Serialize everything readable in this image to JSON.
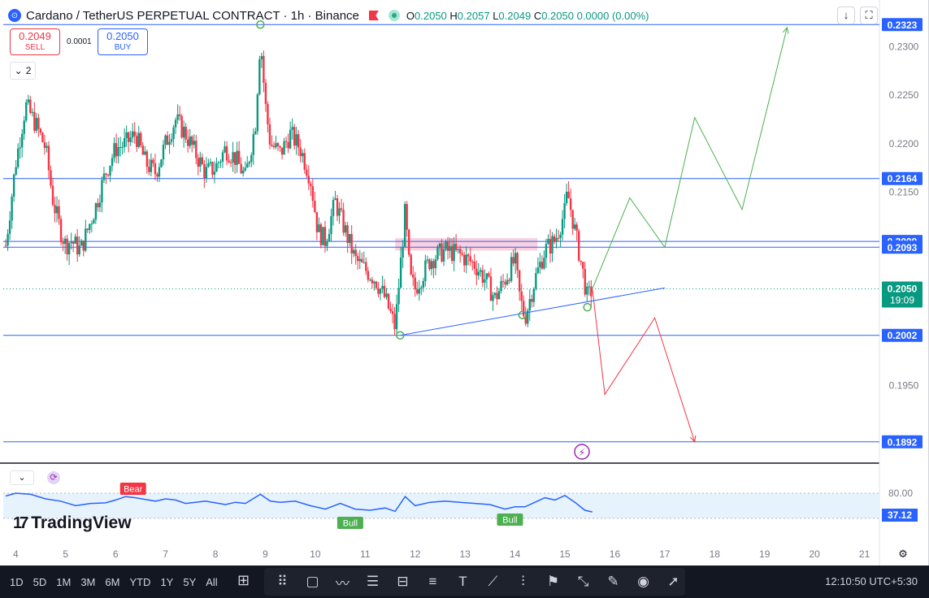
{
  "header": {
    "symbol_title": "Cardano / TetherUS PERPETUAL CONTRACT · 1h · Binance",
    "o_label": "O",
    "o_value": "0.2050",
    "h_label": "H",
    "h_value": "0.2057",
    "l_label": "L",
    "l_value": "0.2049",
    "c_label": "C",
    "c_value": "0.2050",
    "change": "0.0000 (0.00%)"
  },
  "trade": {
    "sell_price": "0.2049",
    "sell_label": "SELL",
    "spread": "0.0001",
    "buy_price": "0.2050",
    "buy_label": "BUY"
  },
  "indicators_count": "2",
  "top_icons": [
    "↓",
    "⛶"
  ],
  "branding": {
    "name": "TradingView",
    "mark": "17"
  },
  "colors": {
    "up": "#089981",
    "down": "#f23645",
    "accent": "#2962ff",
    "projection_up": "#4caf50",
    "projection_down": "#f23645"
  },
  "chart_data": {
    "type": "candlestick",
    "interval": "1h",
    "y_axis": {
      "min": 0.187,
      "max": 0.234,
      "ticks": [
        "0.2300",
        "0.2250",
        "0.2200",
        "0.2150",
        "0.1950"
      ]
    },
    "x_axis": {
      "ticks": [
        "4",
        "5",
        "6",
        "7",
        "8",
        "9",
        "10",
        "11",
        "12",
        "13",
        "14",
        "15",
        "16",
        "17",
        "18",
        "19",
        "20",
        "21"
      ]
    },
    "x_tick_values": [
      4,
      5,
      6,
      7,
      8,
      9,
      10,
      11,
      12,
      13,
      14,
      15,
      16,
      17,
      18,
      19,
      20,
      21
    ],
    "x_range": [
      3.75,
      21.3
    ],
    "close_path": [
      [
        3.8,
        0.2095
      ],
      [
        4.0,
        0.218
      ],
      [
        4.2,
        0.224
      ],
      [
        4.4,
        0.222
      ],
      [
        4.6,
        0.2195
      ],
      [
        4.75,
        0.214
      ],
      [
        4.9,
        0.211
      ],
      [
        5.0,
        0.2095
      ],
      [
        5.1,
        0.21
      ],
      [
        5.3,
        0.209
      ],
      [
        5.6,
        0.2135
      ],
      [
        5.8,
        0.217
      ],
      [
        6.0,
        0.2195
      ],
      [
        6.2,
        0.22
      ],
      [
        6.4,
        0.221
      ],
      [
        6.6,
        0.218
      ],
      [
        6.8,
        0.217
      ],
      [
        7.0,
        0.22
      ],
      [
        7.2,
        0.2225
      ],
      [
        7.4,
        0.221
      ],
      [
        7.6,
        0.219
      ],
      [
        7.8,
        0.217
      ],
      [
        8.0,
        0.2175
      ],
      [
        8.2,
        0.2195
      ],
      [
        8.4,
        0.2185
      ],
      [
        8.6,
        0.2165
      ],
      [
        8.8,
        0.222
      ],
      [
        8.9,
        0.231
      ],
      [
        9.0,
        0.224
      ],
      [
        9.1,
        0.22
      ],
      [
        9.3,
        0.219
      ],
      [
        9.5,
        0.221
      ],
      [
        9.7,
        0.2195
      ],
      [
        9.9,
        0.2165
      ],
      [
        10.05,
        0.211
      ],
      [
        10.2,
        0.21
      ],
      [
        10.4,
        0.214
      ],
      [
        10.6,
        0.211
      ],
      [
        10.8,
        0.208
      ],
      [
        11.0,
        0.207
      ],
      [
        11.2,
        0.206
      ],
      [
        11.4,
        0.204
      ],
      [
        11.6,
        0.201
      ],
      [
        11.7,
        0.207
      ],
      [
        11.8,
        0.213
      ],
      [
        11.9,
        0.206
      ],
      [
        12.0,
        0.205
      ],
      [
        12.3,
        0.208
      ],
      [
        12.6,
        0.209
      ],
      [
        12.9,
        0.2085
      ],
      [
        13.2,
        0.2075
      ],
      [
        13.4,
        0.206
      ],
      [
        13.6,
        0.204
      ],
      [
        13.8,
        0.206
      ],
      [
        14.0,
        0.208
      ],
      [
        14.1,
        0.204
      ],
      [
        14.2,
        0.202
      ],
      [
        14.4,
        0.206
      ],
      [
        14.6,
        0.209
      ],
      [
        14.8,
        0.21
      ],
      [
        15.0,
        0.213
      ],
      [
        15.05,
        0.215
      ],
      [
        15.2,
        0.211
      ],
      [
        15.35,
        0.207
      ],
      [
        15.45,
        0.204
      ],
      [
        15.55,
        0.205
      ]
    ],
    "horizontal_levels": [
      {
        "price": 0.2323,
        "label": "0.2323"
      },
      {
        "price": 0.2164,
        "label": "0.2164"
      },
      {
        "price": 0.2099,
        "label": "0.2099"
      },
      {
        "price": 0.2093,
        "label": "0.2093"
      },
      {
        "price": 0.2002,
        "label": "0.2002"
      },
      {
        "price": 0.1892,
        "label": "0.1892"
      }
    ],
    "current_price": {
      "price": 0.205,
      "label": "0.2050",
      "countdown": "19:09"
    },
    "supply_zone": {
      "x_from": 11.6,
      "x_to": 14.45,
      "y_from": 0.2093,
      "y_to": 0.2099
    },
    "trendline": {
      "from": [
        11.7,
        0.2002
      ],
      "to": [
        17.0,
        0.2051
      ]
    },
    "pivot_markers": [
      [
        8.9,
        0.2323
      ],
      [
        11.7,
        0.2002
      ],
      [
        14.15,
        0.2023
      ],
      [
        15.45,
        0.2031
      ]
    ],
    "bullish_projection": [
      [
        15.55,
        0.205
      ],
      [
        16.3,
        0.2144
      ],
      [
        17.0,
        0.2093
      ],
      [
        17.6,
        0.2227
      ],
      [
        18.55,
        0.2132
      ],
      [
        19.45,
        0.232
      ]
    ],
    "bearish_projection": [
      [
        15.55,
        0.205
      ],
      [
        15.8,
        0.1941
      ],
      [
        16.8,
        0.202
      ],
      [
        17.6,
        0.1892
      ]
    ],
    "rsi": {
      "levels": [
        "80.00"
      ],
      "current": "37.12",
      "labels": [
        "Bear",
        "Bull",
        "Bull"
      ],
      "values": [
        [
          3.8,
          75
        ],
        [
          4.0,
          80
        ],
        [
          4.3,
          78
        ],
        [
          4.6,
          70
        ],
        [
          4.9,
          66
        ],
        [
          5.2,
          58
        ],
        [
          5.5,
          62
        ],
        [
          5.8,
          63
        ],
        [
          6.0,
          68
        ],
        [
          6.2,
          74
        ],
        [
          6.4,
          72
        ],
        [
          6.6,
          69
        ],
        [
          6.8,
          66
        ],
        [
          7.0,
          70
        ],
        [
          7.2,
          68
        ],
        [
          7.4,
          62
        ],
        [
          7.6,
          64
        ],
        [
          7.8,
          66
        ],
        [
          8.0,
          63
        ],
        [
          8.2,
          60
        ],
        [
          8.4,
          64
        ],
        [
          8.6,
          62
        ],
        [
          8.9,
          78
        ],
        [
          9.1,
          66
        ],
        [
          9.3,
          64
        ],
        [
          9.6,
          66
        ],
        [
          9.9,
          58
        ],
        [
          10.2,
          52
        ],
        [
          10.5,
          62
        ],
        [
          10.8,
          52
        ],
        [
          11.1,
          50
        ],
        [
          11.4,
          54
        ],
        [
          11.6,
          48
        ],
        [
          11.8,
          74
        ],
        [
          12.0,
          58
        ],
        [
          12.3,
          64
        ],
        [
          12.6,
          66
        ],
        [
          12.9,
          64
        ],
        [
          13.2,
          62
        ],
        [
          13.5,
          60
        ],
        [
          13.8,
          52
        ],
        [
          14.0,
          56
        ],
        [
          14.2,
          56
        ],
        [
          14.4,
          64
        ],
        [
          14.6,
          72
        ],
        [
          14.8,
          68
        ],
        [
          15.0,
          76
        ],
        [
          15.2,
          64
        ],
        [
          15.4,
          50
        ],
        [
          15.55,
          47
        ]
      ]
    }
  },
  "time_ranges": [
    "1D",
    "5D",
    "1M",
    "3M",
    "6M",
    "YTD",
    "1Y",
    "5Y",
    "All"
  ],
  "drawing_tools": [
    "cursor-grid",
    "rectangle",
    "path",
    "fib",
    "long-short",
    "parallel-channel",
    "text",
    "trend-line",
    "pitchfork",
    "flag-marker",
    "ruler",
    "brush",
    "eye",
    "arrow"
  ],
  "clock": "12:10:50 UTC+5:30"
}
